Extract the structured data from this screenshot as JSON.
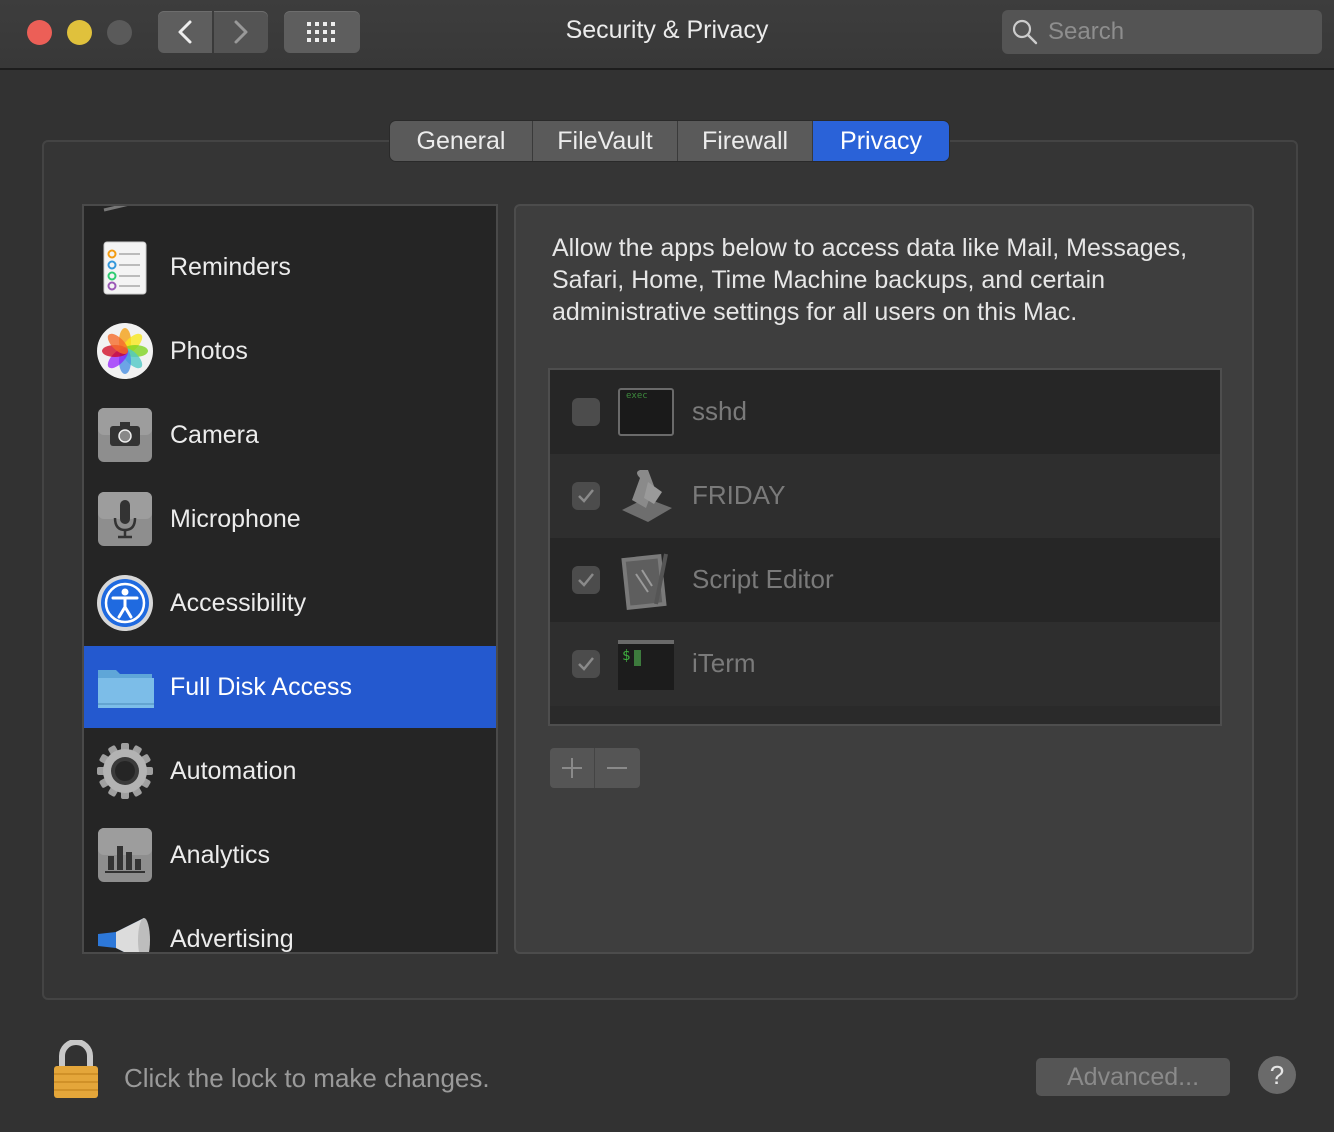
{
  "window": {
    "title": "Security & Privacy",
    "search_placeholder": "Search"
  },
  "tabs": [
    {
      "label": "General"
    },
    {
      "label": "FileVault"
    },
    {
      "label": "Firewall"
    },
    {
      "label": "Privacy",
      "active": true
    }
  ],
  "categories": [
    {
      "label": "Reminders",
      "icon": "reminders-icon"
    },
    {
      "label": "Photos",
      "icon": "photos-icon"
    },
    {
      "label": "Camera",
      "icon": "camera-icon"
    },
    {
      "label": "Microphone",
      "icon": "microphone-icon"
    },
    {
      "label": "Accessibility",
      "icon": "accessibility-icon"
    },
    {
      "label": "Full Disk Access",
      "icon": "folder-icon",
      "selected": true
    },
    {
      "label": "Automation",
      "icon": "gear-icon"
    },
    {
      "label": "Analytics",
      "icon": "analytics-icon"
    },
    {
      "label": "Advertising",
      "icon": "megaphone-icon"
    }
  ],
  "panel": {
    "description": "Allow the apps below to access data like Mail, Messages, Safari, Home, Time Machine backups, and certain administrative settings for all users on this Mac.",
    "apps": [
      {
        "name": "sshd",
        "checked": false,
        "icon": "exec-icon",
        "icon_text": "exec"
      },
      {
        "name": "FRIDAY",
        "checked": true,
        "icon": "script-scroll-icon"
      },
      {
        "name": "Script Editor",
        "checked": true,
        "icon": "script-editor-icon"
      },
      {
        "name": "iTerm",
        "checked": true,
        "icon": "iterm-icon",
        "icon_text": "$"
      }
    ],
    "add_label": "+",
    "remove_label": "−"
  },
  "footer": {
    "lock_text": "Click the lock to make changes.",
    "advanced_label": "Advanced...",
    "help_label": "?"
  },
  "colors": {
    "accent": "#2459cf",
    "window_bg": "#323232"
  }
}
